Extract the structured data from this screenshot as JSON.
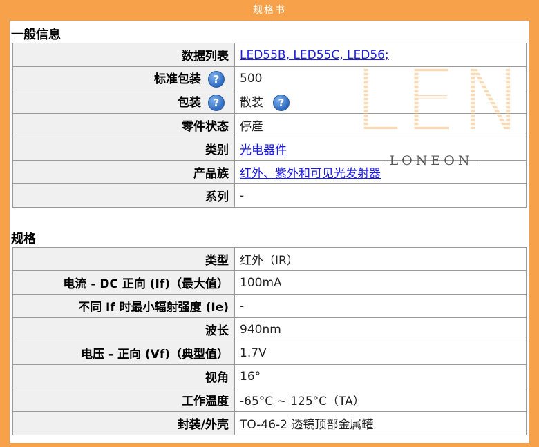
{
  "banner": {
    "title": "规格书"
  },
  "general": {
    "heading": "一般信息",
    "rows": [
      {
        "label": "数据列表",
        "value": "LED55B, LED55C, LED56;",
        "link": true
      },
      {
        "label": "标准包装",
        "value": "500",
        "help": true
      },
      {
        "label": "包装",
        "value": "散装",
        "help": true,
        "value_help": true
      },
      {
        "label": "零件状态",
        "value": "停産"
      },
      {
        "label": "类别",
        "value": "光电器件",
        "link": true
      },
      {
        "label": "产品族",
        "value": "红外、紫外和可见光发射器",
        "link": true
      },
      {
        "label": "系列",
        "value": "-"
      }
    ]
  },
  "specs": {
    "heading": "规格",
    "rows": [
      {
        "label": "类型",
        "value": "红外（IR）"
      },
      {
        "label": "电流 - DC 正向 (If)（最大值）",
        "value": "100mA"
      },
      {
        "label": "不同 If 时最小辐射强度 (Ie)",
        "value": "-"
      },
      {
        "label": "波长",
        "value": "940nm"
      },
      {
        "label": "电压 - 正向 (Vf)（典型值）",
        "value": "1.7V"
      },
      {
        "label": "视角",
        "value": "16°"
      },
      {
        "label": "工作温度",
        "value": "-65°C ~ 125°C（TA）"
      },
      {
        "label": "封装/外壳",
        "value": "TO-46-2 透镜顶部金属罐"
      }
    ]
  },
  "help_icon": {
    "name": "question-help-icon",
    "glyph": "?"
  },
  "watermark": {
    "letters": "LEN",
    "sub": "LONEON"
  },
  "colors": {
    "frame": "#f7a24a",
    "label_bg": "#f0f0f0",
    "link": "#1a1aee",
    "border": "#9a9a9a"
  }
}
